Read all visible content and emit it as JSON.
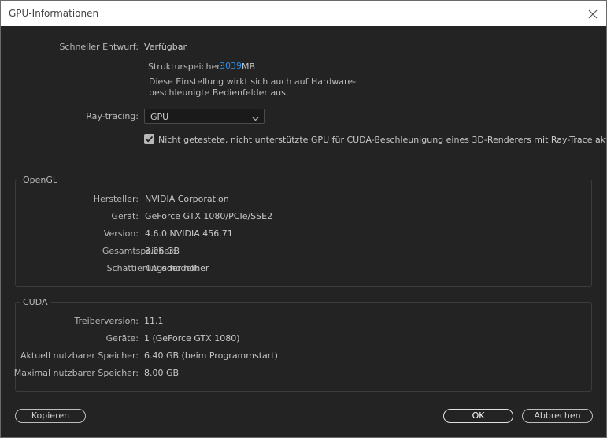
{
  "window": {
    "title": "GPU-Informationen",
    "close_icon": "close-icon"
  },
  "draft": {
    "label": "Schneller Entwurf:",
    "value": "Verfügbar",
    "memory_label": "Strukturspeicher:",
    "memory_value": "3039",
    "memory_unit": "MB",
    "note_line1": "Diese Einstellung wirkt sich auch auf Hardware-",
    "note_line2": "beschleunigte Bedienfelder aus."
  },
  "raytracing": {
    "label": "Ray-tracing:",
    "selected": "GPU",
    "checkbox_checked": true,
    "checkbox_label": "Nicht getestete, nicht unterstützte GPU für CUDA-Beschleunigung eines 3D-Renderers mit Ray-Trace aktivieren"
  },
  "opengl": {
    "title": "OpenGL",
    "rows": [
      {
        "label": "Hersteller:",
        "value": "NVIDIA Corporation"
      },
      {
        "label": "Gerät:",
        "value": "GeForce GTX 1080/PCIe/SSE2"
      },
      {
        "label": "Version:",
        "value": "4.6.0 NVIDIA 456.71"
      },
      {
        "label": "Gesamtspeicher:",
        "value": "3.96 GB"
      },
      {
        "label": "Schattierungsmodell:",
        "value": "4.0 oder höher"
      }
    ]
  },
  "cuda": {
    "title": "CUDA",
    "rows": [
      {
        "label": "Treiberversion:",
        "value": "11.1"
      },
      {
        "label": "Geräte:",
        "value": "1 (GeForce GTX 1080)"
      },
      {
        "label": "Aktuell nutzbarer Speicher:",
        "value": "6.40 GB (beim Programmstart)"
      },
      {
        "label": "Maximal nutzbarer Speicher:",
        "value": "8.00 GB"
      }
    ]
  },
  "buttons": {
    "copy": "Kopieren",
    "ok": "OK",
    "cancel": "Abbrechen"
  },
  "colors": {
    "accent": "#2b8ee5",
    "background": "#232323",
    "titlebar": "#ffffff"
  }
}
